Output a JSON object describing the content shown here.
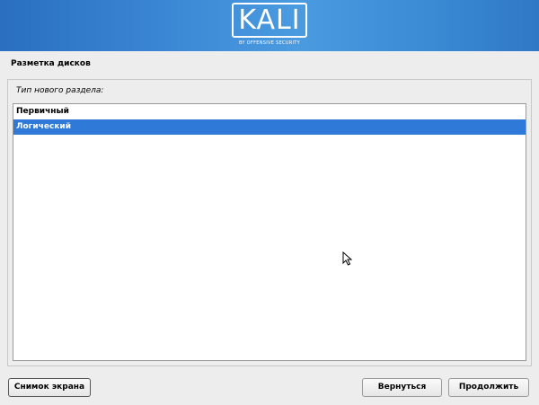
{
  "banner": {
    "logo": "KALI",
    "tagline": "BY OFFENSIVE SECURITY"
  },
  "page": {
    "title": "Разметка дисков",
    "question": "Тип нового раздела:"
  },
  "options": [
    {
      "label": "Первичный",
      "selected": false
    },
    {
      "label": "Логический",
      "selected": true
    }
  ],
  "buttons": {
    "screenshot": "Снимок экрана",
    "back": "Вернуться",
    "continue": "Продолжить"
  },
  "colors": {
    "selection": "#2f7ad8",
    "banner": "#3a86d4"
  }
}
